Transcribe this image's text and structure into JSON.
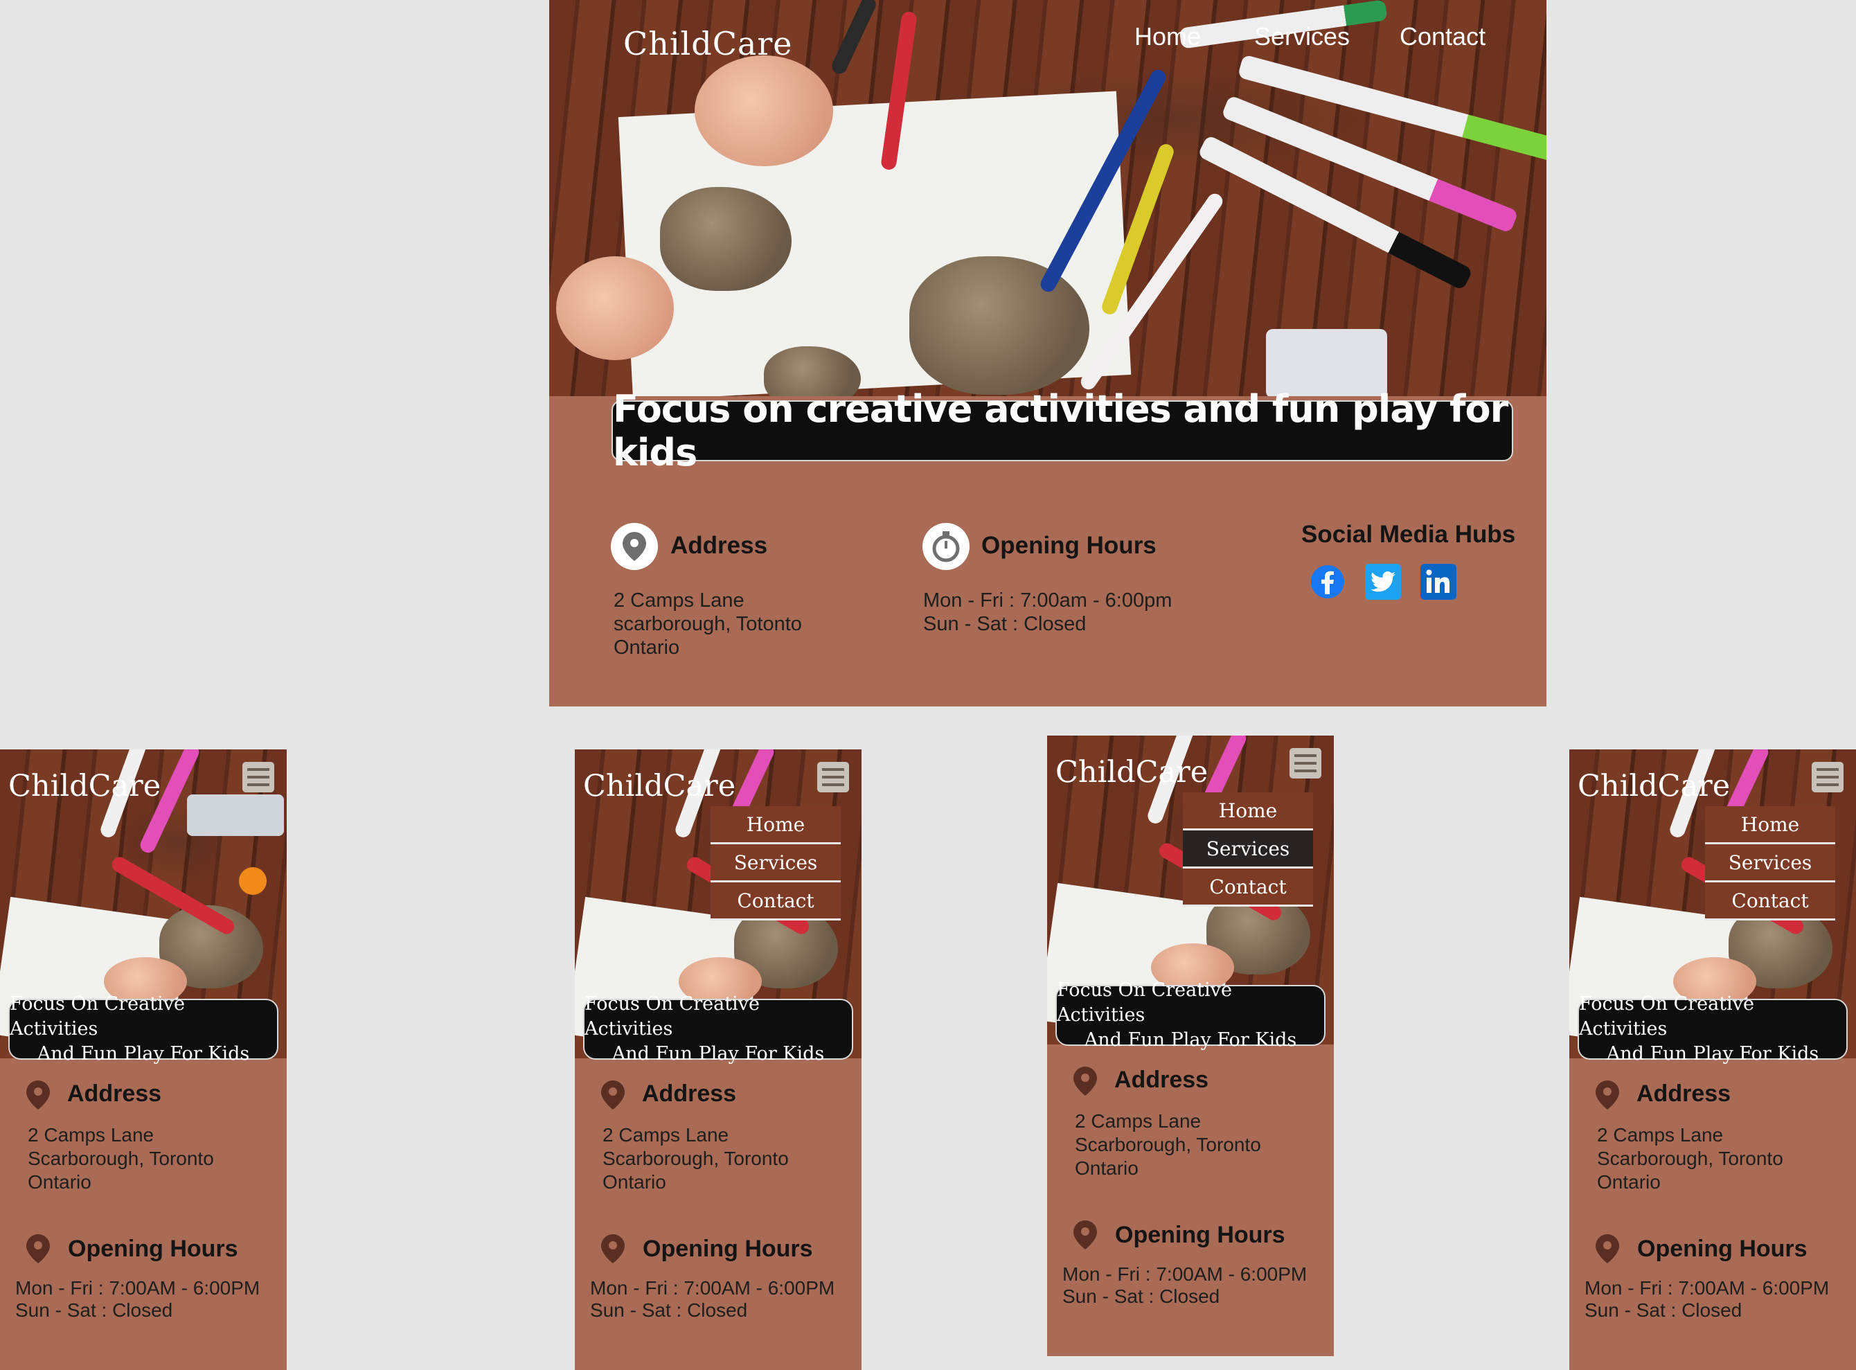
{
  "desktop": {
    "logo": "ChildCare",
    "nav": [
      "Home",
      "Services",
      "Contact"
    ],
    "hero_banner": "Focus on creative activities and fun play for kids",
    "address": {
      "title": "Address",
      "lines": [
        "2 Camps Lane",
        "scarborough, Totonto",
        "Ontario"
      ]
    },
    "hours": {
      "title": "Opening Hours",
      "lines": [
        "Mon - Fri : 7:00am - 6:00pm",
        "Sun - Sat : Closed"
      ]
    },
    "social": {
      "title": "Social Media Hubs",
      "icons": [
        "facebook-icon",
        "twitter-icon",
        "linkedin-icon"
      ]
    }
  },
  "mobile": {
    "logo": "ChildCare",
    "banner_lines": [
      "Focus On Creative Activities",
      "And  Fun Play For Kids"
    ],
    "menu": [
      "Home",
      "Services",
      "Contact"
    ],
    "address": {
      "title": "Address",
      "lines": [
        "2 Camps Lane",
        "Scarborough, Toronto",
        "Ontario"
      ]
    },
    "hours": {
      "title": "Opening Hours",
      "lines": [
        "Mon - Fri : 7:00AM - 6:00PM",
        "Sun - Sat   : Closed"
      ]
    }
  },
  "colors": {
    "brown": "#a96b55",
    "menu_brown": "#7d3a24",
    "menu_active": "#2a2323",
    "facebook": "#1877f2",
    "twitter": "#1da1f2",
    "linkedin": "#0a66c2"
  }
}
